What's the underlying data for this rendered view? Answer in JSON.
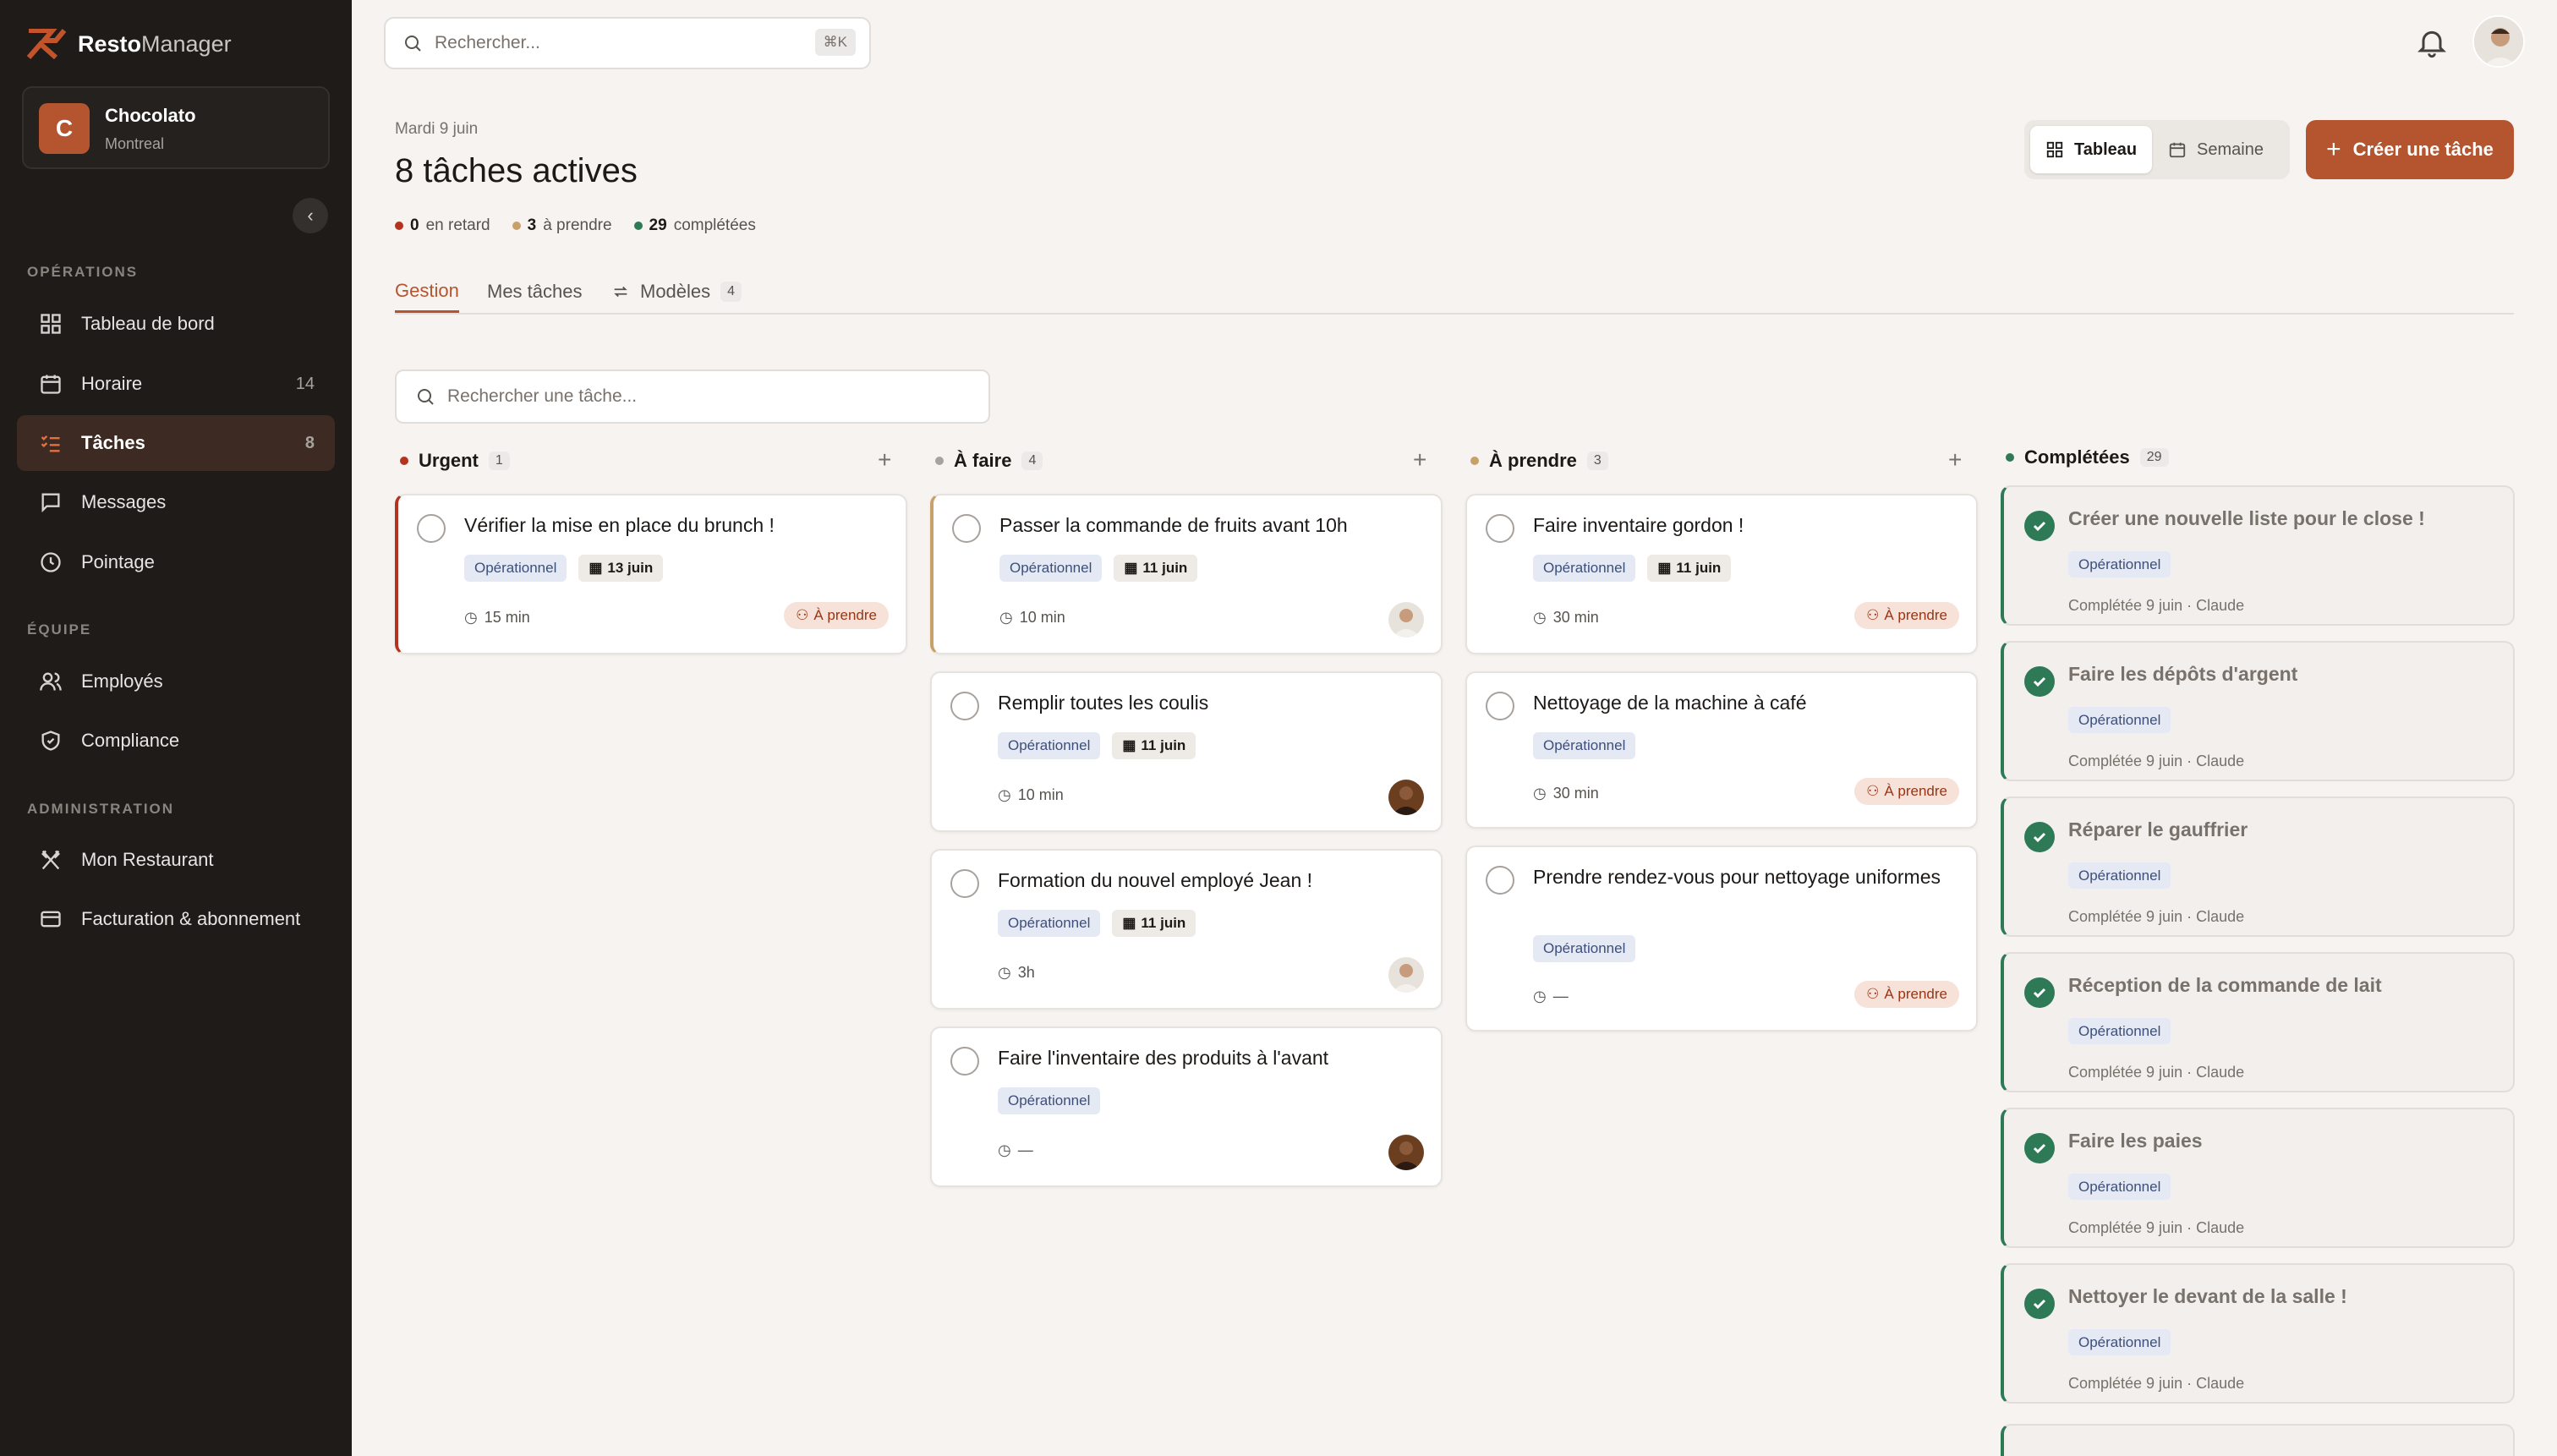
{
  "app": {
    "brand_bold": "Resto",
    "brand_light": "Manager"
  },
  "restaurant": {
    "initial": "C",
    "name": "Chocolato",
    "city": "Montreal"
  },
  "sidebar": {
    "sections": [
      "OPÉRATIONS",
      "ÉQUIPE",
      "ADMINISTRATION"
    ],
    "items": [
      {
        "label": "Tableau de bord",
        "icon": "dashboard-icon",
        "count": ""
      },
      {
        "label": "Horaire",
        "icon": "calendar-icon",
        "count": "14"
      },
      {
        "label": "Tâches",
        "icon": "tasks-icon",
        "count": "8"
      },
      {
        "label": "Messages",
        "icon": "message-icon",
        "count": ""
      },
      {
        "label": "Pointage",
        "icon": "clock-icon",
        "count": ""
      },
      {
        "label": "Employés",
        "icon": "users-icon",
        "count": ""
      },
      {
        "label": "Compliance",
        "icon": "shield-icon",
        "count": ""
      },
      {
        "label": "Mon Restaurant",
        "icon": "utensils-icon",
        "count": ""
      },
      {
        "label": "Facturation & abonnement",
        "icon": "credit-card-icon",
        "count": ""
      }
    ]
  },
  "search": {
    "placeholder": "Rechercher...",
    "shortcut": "⌘K"
  },
  "header": {
    "date": "Mardi 9 juin",
    "title": "8 tâches actives",
    "stats": [
      {
        "value": "0",
        "label": "en retard",
        "color": "#b4331f"
      },
      {
        "value": "3",
        "label": "à prendre",
        "color": "#c8a06a"
      },
      {
        "value": "29",
        "label": "complétées",
        "color": "#2f7a56"
      }
    ],
    "view_board": "Tableau",
    "view_week": "Semaine",
    "create": "Créer une tâche"
  },
  "tabs": [
    {
      "label": "Gestion"
    },
    {
      "label": "Mes tâches"
    },
    {
      "label": "Modèles",
      "count": "4"
    }
  ],
  "task_search": {
    "placeholder": "Rechercher une tâche..."
  },
  "columns": [
    {
      "name": "Urgent",
      "count": "1",
      "color": "#b4331f"
    },
    {
      "name": "À faire",
      "count": "4",
      "color": "#a8a29e"
    },
    {
      "name": "À prendre",
      "count": "3",
      "color": "#c8a06a"
    },
    {
      "name": "Complétées",
      "count": "29",
      "color": "#2f7a56"
    }
  ],
  "cards": {
    "urgent": [
      {
        "title": "Vérifier la mise en place du brunch !",
        "tag": "Opérationnel",
        "date": "13 juin",
        "duration": "15 min",
        "action": "À prendre"
      }
    ],
    "todo": [
      {
        "title": "Passer la commande de fruits avant 10h",
        "tag": "Opérationnel",
        "date": "11 juin",
        "duration": "10 min"
      },
      {
        "title": "Remplir toutes les coulis",
        "tag": "Opérationnel",
        "date": "11 juin",
        "duration": "10 min"
      },
      {
        "title": "Formation du nouvel employé Jean !",
        "tag": "Opérationnel",
        "date": "11 juin",
        "duration": "3h"
      },
      {
        "title": "Faire l'inventaire des produits à l'avant",
        "tag": "Opérationnel",
        "duration": "—"
      }
    ],
    "take": [
      {
        "title": "Faire inventaire gordon !",
        "tag": "Opérationnel",
        "date": "11 juin",
        "duration": "30 min",
        "action": "À prendre"
      },
      {
        "title": "Nettoyage de la machine à café",
        "tag": "Opérationnel",
        "duration": "30 min",
        "action": "À prendre"
      },
      {
        "title": "Prendre rendez-vous pour nettoyage uniformes",
        "tag": "Opérationnel",
        "duration": "—",
        "action": "À prendre"
      }
    ],
    "done": [
      {
        "title": "Créer une nouvelle liste pour le close !",
        "tag": "Opérationnel",
        "meta": "Complétée 9 juin · Claude"
      },
      {
        "title": "Faire les dépôts d'argent",
        "tag": "Opérationnel",
        "meta": "Complétée 9 juin · Claude"
      },
      {
        "title": "Réparer le gauffrier",
        "tag": "Opérationnel",
        "meta": "Complétée 9 juin · Claude"
      },
      {
        "title": "Réception de la commande de lait",
        "tag": "Opérationnel",
        "meta": "Complétée 9 juin · Claude"
      },
      {
        "title": "Faire les paies",
        "tag": "Opérationnel",
        "meta": "Complétée 9 juin · Claude"
      },
      {
        "title": "Nettoyer le devant de la salle !",
        "tag": "Opérationnel",
        "meta": "Complétée 9 juin · Claude"
      }
    ]
  }
}
